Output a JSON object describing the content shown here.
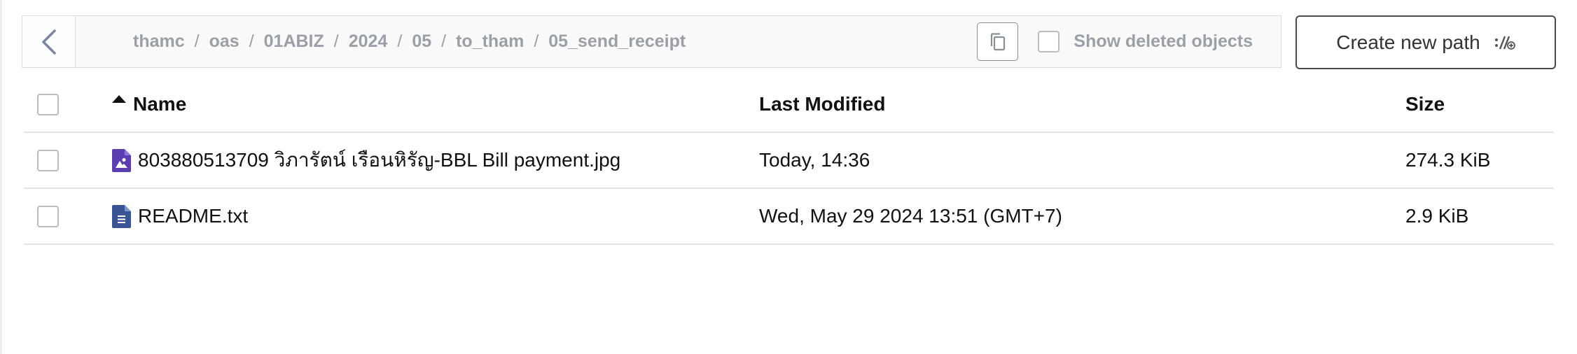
{
  "breadcrumb": [
    "thamc",
    "oas",
    "01ABIZ",
    "2024",
    "05",
    "to_tham",
    "05_send_receipt"
  ],
  "breadcrumb_separator": "/",
  "show_deleted_label": "Show deleted objects",
  "create_new_path_label": "Create new path",
  "table": {
    "columns": {
      "name": "Name",
      "modified": "Last Modified",
      "size": "Size"
    },
    "sort": {
      "column": "name",
      "direction": "ascending"
    },
    "rows": [
      {
        "name": "803880513709 วิภารัตน์ เรือนหิรัญ-BBL Bill payment.jpg",
        "modified": "Today, 14:36",
        "size": "274.3 KiB",
        "icon": "image-file-icon",
        "icon_color": "#5b3fb0"
      },
      {
        "name": "README.txt",
        "modified": "Wed, May 29 2024 13:51 (GMT+7)",
        "size": "2.9 KiB",
        "icon": "text-file-icon",
        "icon_color": "#3a5595"
      }
    ]
  }
}
